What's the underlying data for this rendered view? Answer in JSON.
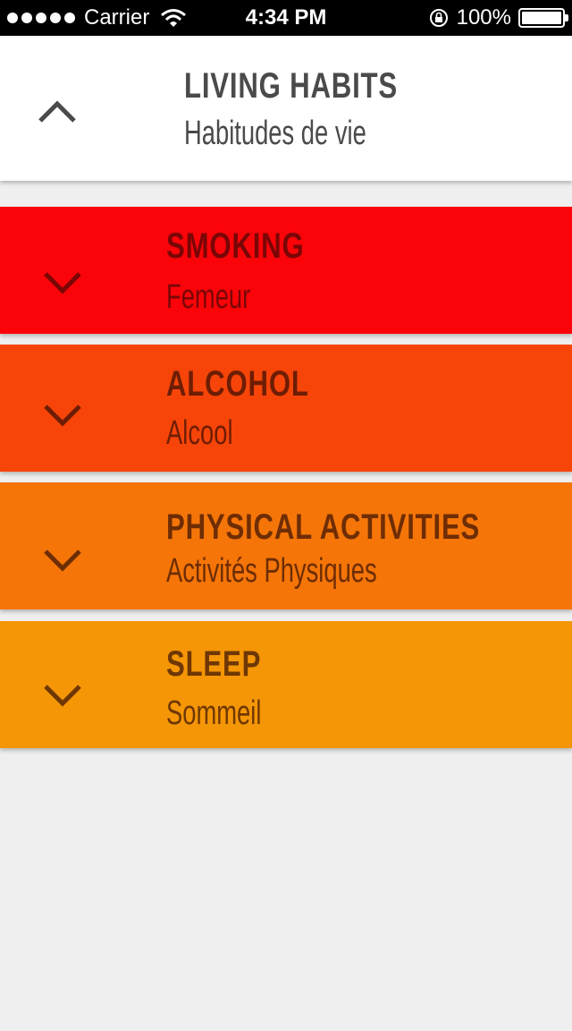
{
  "status_bar": {
    "carrier": "Carrier",
    "time": "4:34 PM",
    "battery": "100%"
  },
  "header": {
    "title": "LIVING HABITS",
    "subtitle": "Habitudes de vie",
    "color": "#4a4a4a",
    "icon": "chevron-up-icon"
  },
  "sections": [
    {
      "title": "SMOKING",
      "subtitle": "Femeur",
      "bg": "#fa0409",
      "fg": "#7a0606",
      "icon": "chevron-down-icon"
    },
    {
      "title": "ALCOHOL",
      "subtitle": "Alcool",
      "bg": "#f74509",
      "fg": "#6e1d04",
      "icon": "chevron-down-icon"
    },
    {
      "title": "PHYSICAL ACTIVITIES",
      "subtitle": "Activités Physiques",
      "bg": "#f57508",
      "fg": "#6e2d04",
      "icon": "chevron-down-icon"
    },
    {
      "title": "SLEEP",
      "subtitle": "Sommeil",
      "bg": "#f59606",
      "fg": "#6e3704",
      "icon": "chevron-down-icon"
    }
  ]
}
